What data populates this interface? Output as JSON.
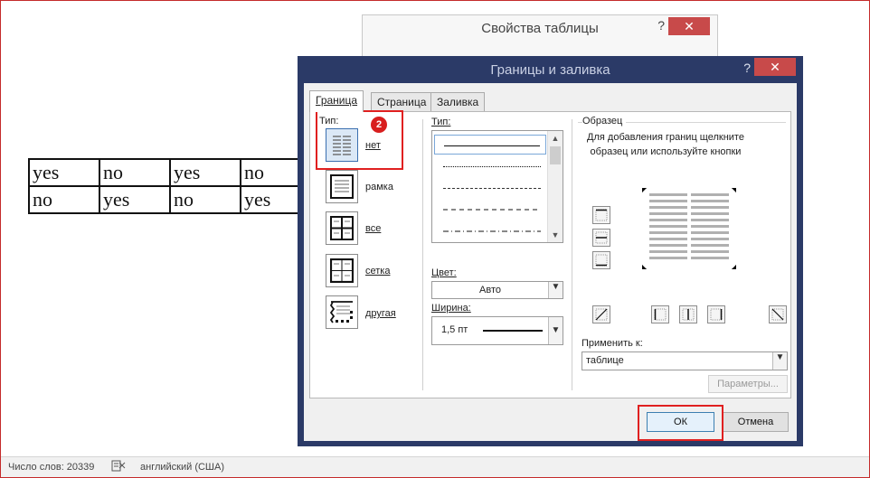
{
  "document": {
    "table_rows": [
      [
        "yes",
        "no",
        "yes",
        "no"
      ],
      [
        "no",
        "yes",
        "no",
        "yes"
      ]
    ]
  },
  "background_dialog": {
    "title": "Свойства таблицы",
    "help": "?",
    "close": "✕"
  },
  "dialog": {
    "title": "Границы и заливка",
    "help": "?",
    "close": "✕",
    "tabs": [
      {
        "label": "Граница",
        "active": true
      },
      {
        "label": "Страница",
        "active": false
      },
      {
        "label": "Заливка",
        "active": false
      }
    ],
    "presets": {
      "label": "Тип:",
      "items": [
        {
          "id": "none",
          "label": "нет",
          "selected": true
        },
        {
          "id": "box",
          "label": "рамка",
          "selected": false
        },
        {
          "id": "all",
          "label": "все",
          "selected": false
        },
        {
          "id": "grid",
          "label": "сетка",
          "selected": false
        },
        {
          "id": "custom",
          "label": "другая",
          "selected": false
        }
      ]
    },
    "badge": "2",
    "style": {
      "label": "Тип:",
      "lines": [
        "solid",
        "dotted",
        "small-dash",
        "dashed",
        "dash-dot"
      ]
    },
    "color": {
      "label": "Цвет:",
      "value": "Авто"
    },
    "width": {
      "label": "Ширина:",
      "value": "1,5 пт"
    },
    "preview": {
      "title": "Образец",
      "hint": "Для добавления границ щелкните образец или используйте кнопки"
    },
    "apply_to": {
      "label": "Применить к:",
      "value": "таблице"
    },
    "options_button": "Параметры...",
    "ok_button": "ОК",
    "cancel_button": "Отмена"
  },
  "status_bar": {
    "word_count": "Число слов: 20339",
    "language": "английский (США)"
  },
  "colors": {
    "dialog_frame": "#2b3a67",
    "close_button": "#c84a4a",
    "highlight": "#e02020",
    "badge": "#d81e1e"
  }
}
